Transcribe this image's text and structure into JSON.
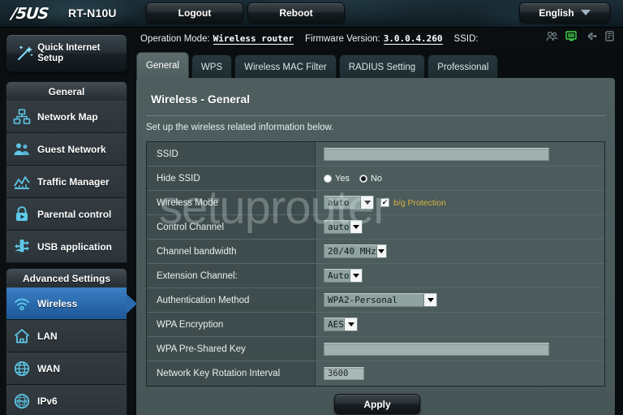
{
  "header": {
    "brand": "/5US",
    "model": "RT-N10U",
    "logout_label": "Logout",
    "reboot_label": "Reboot",
    "language_label": "English"
  },
  "infobar": {
    "operation_mode_label": "Operation Mode:",
    "operation_mode_value": "Wireless router",
    "firmware_label": "Firmware Version:",
    "firmware_value": "3.0.0.4.260",
    "ssid_label": "SSID:",
    "ssid_value": "",
    "status_icons": [
      "clients-icon",
      "monitor-icon",
      "usb-icon",
      "printer-icon"
    ]
  },
  "sidebar": {
    "quick_setup_label": "Quick Internet Setup",
    "quick_setup_icon": "magic-wand-icon",
    "general_header": "General",
    "general_items": [
      {
        "label": "Network Map",
        "icon": "network-map-icon"
      },
      {
        "label": "Guest Network",
        "icon": "guest-network-icon"
      },
      {
        "label": "Traffic Manager",
        "icon": "traffic-manager-icon"
      },
      {
        "label": "Parental control",
        "icon": "parental-control-icon"
      },
      {
        "label": "USB application",
        "icon": "usb-application-icon"
      }
    ],
    "advanced_header": "Advanced Settings",
    "advanced_items": [
      {
        "label": "Wireless",
        "icon": "wireless-icon",
        "active": true
      },
      {
        "label": "LAN",
        "icon": "lan-home-icon",
        "active": false
      },
      {
        "label": "WAN",
        "icon": "wan-globe-icon",
        "active": false
      },
      {
        "label": "IPv6",
        "icon": "ipv6-globe-icon",
        "active": false
      }
    ]
  },
  "tabs": [
    {
      "label": "General",
      "active": true
    },
    {
      "label": "WPS",
      "active": false
    },
    {
      "label": "Wireless MAC Filter",
      "active": false
    },
    {
      "label": "RADIUS Setting",
      "active": false
    },
    {
      "label": "Professional",
      "active": false
    }
  ],
  "panel": {
    "title": "Wireless - General",
    "description": "Set up the wireless related information below.",
    "apply_label": "Apply"
  },
  "form": {
    "ssid": {
      "label": "SSID",
      "value": ""
    },
    "hide_ssid": {
      "label": "Hide SSID",
      "options": [
        {
          "label": "Yes",
          "checked": false
        },
        {
          "label": "No",
          "checked": true
        }
      ]
    },
    "wireless_mode": {
      "label": "Wireless Mode",
      "value": "auto",
      "protection_label": "b/g Protection",
      "protection_checked": true,
      "protection_mark": "✔"
    },
    "control_channel": {
      "label": "Control Channel",
      "value": "auto"
    },
    "channel_bandwidth": {
      "label": "Channel bandwidth",
      "value": "20/40 MHz"
    },
    "extension_channel": {
      "label": "Extension Channel:",
      "value": "Auto"
    },
    "authentication_method": {
      "label": "Authentication Method",
      "value": "WPA2-Personal"
    },
    "wpa_encryption": {
      "label": "WPA Encryption",
      "value": "AES"
    },
    "wpa_psk": {
      "label": "WPA Pre-Shared Key",
      "value": ""
    },
    "key_rotation": {
      "label": "Network Key Rotation Interval",
      "value": "3600"
    }
  },
  "watermark": {
    "text": "setuprouter"
  },
  "colors": {
    "accent_blue": "#2a6aad",
    "panel_bg": "#4e5e5f",
    "key_cell_bg": "#3e4c4d",
    "icon_cyan": "#5ec8e8",
    "warning_gold": "#d6b23c",
    "status_green": "#3fd44a"
  }
}
